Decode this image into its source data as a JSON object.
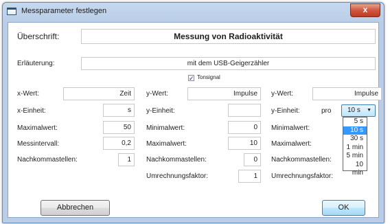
{
  "window": {
    "title": "Messparameter festlegen",
    "close_label": "x"
  },
  "header": {
    "heading_label": "Überschrift:",
    "heading_value": "Messung von Radioaktivität",
    "note_label": "Erläuterung:",
    "note_value": "mit dem USB-Geigerzähler",
    "tone_label": "Tonsignal",
    "tone_checked": "✓"
  },
  "x_col": {
    "value_label": "x-Wert:",
    "value": "Zeit",
    "unit_label": "x-Einheit:",
    "unit": "s",
    "max_label": "Maximalwert:",
    "max": "50",
    "interval_label": "Messintervall:",
    "interval": "0,2",
    "decimals_label": "Nachkommastellen:",
    "decimals": "1"
  },
  "y_col1": {
    "value_label": "y-Wert:",
    "value": "Impulse",
    "unit_label": "y-Einheit:",
    "unit": "",
    "min_label": "Minimalwert:",
    "min": "0",
    "max_label": "Maximalwert:",
    "max": "10",
    "decimals_label": "Nachkommastellen:",
    "decimals": "0",
    "factor_label": "Umrechnungsfaktor:",
    "factor": "1"
  },
  "y_col2": {
    "value_label": "y-Wert:",
    "value": "Impulse",
    "unit_label": "y-Einheit:",
    "per_label": "pro",
    "combo_value": "10 s",
    "min_label": "Minimalwert:",
    "max_label": "Maximalwert:",
    "decimals_label": "Nachkommastellen:",
    "factor_label": "Umrechnungsfaktor:",
    "options": [
      "5 s",
      "10 s",
      "30 s",
      "1 min",
      "5 min",
      "10 min"
    ],
    "selected_option": "10 s"
  },
  "buttons": {
    "cancel": "Abbrechen",
    "ok": "OK"
  }
}
